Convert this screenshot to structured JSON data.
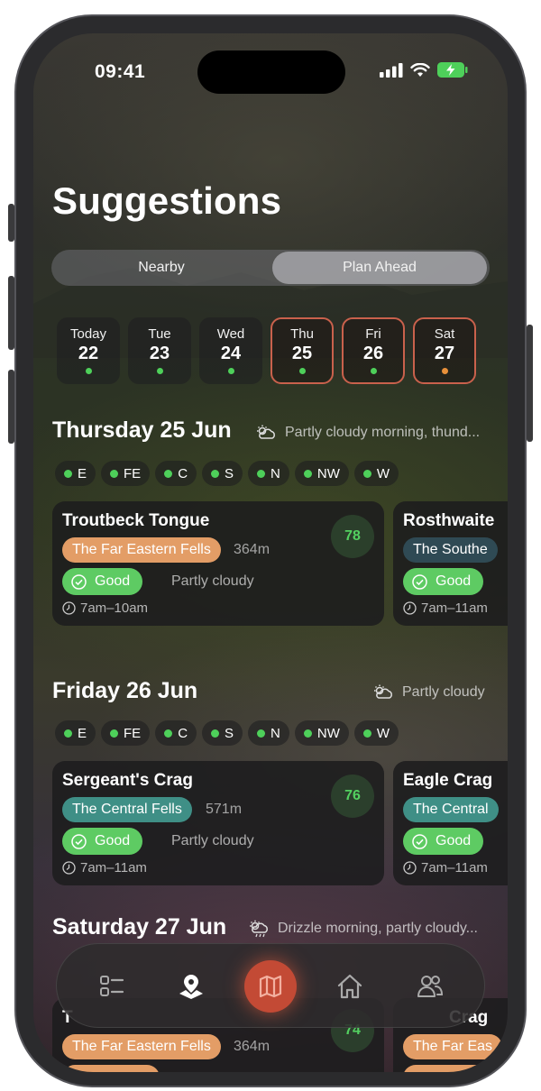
{
  "status": {
    "time": "09:41"
  },
  "page": {
    "title": "Suggestions"
  },
  "segmented": {
    "options": [
      "Nearby",
      "Plan Ahead"
    ],
    "selected": "Plan Ahead"
  },
  "days": [
    {
      "name": "Today",
      "date": "22",
      "dot": "#4ed05a",
      "selected": false
    },
    {
      "name": "Tue",
      "date": "23",
      "dot": "#4ed05a",
      "selected": false
    },
    {
      "name": "Wed",
      "date": "24",
      "dot": "#4ed05a",
      "selected": false
    },
    {
      "name": "Thu",
      "date": "25",
      "dot": "#4ed05a",
      "selected": true
    },
    {
      "name": "Fri",
      "date": "26",
      "dot": "#4ed05a",
      "selected": true
    },
    {
      "name": "Sat",
      "date": "27",
      "dot": "#e8903a",
      "selected": true
    }
  ],
  "regions": [
    "E",
    "FE",
    "C",
    "S",
    "N",
    "NW",
    "W"
  ],
  "sections": [
    {
      "heading": "Thursday 25 Jun",
      "weather": "Partly cloudy morning, thund...",
      "weather_icon": "partly-cloudy-thunder-icon",
      "cards": [
        {
          "name": "Troutbeck Tongue",
          "fell": "The Far Eastern Fells",
          "fell_color": "#e39d66",
          "height": "364m",
          "rating": "Good",
          "condition": "Partly cloudy",
          "time": "7am–10am",
          "score": "78"
        },
        {
          "name": "Rosthwaite",
          "fell": "The Southe",
          "fell_color": "#2f4a54",
          "height": "",
          "rating": "Good",
          "condition": "",
          "time": "7am–11am",
          "score": ""
        }
      ]
    },
    {
      "heading": "Friday 26 Jun",
      "weather": "Partly cloudy",
      "weather_icon": "partly-cloudy-icon",
      "cards": [
        {
          "name": "Sergeant's Crag",
          "fell": "The Central Fells",
          "fell_color": "#3f8f86",
          "height": "571m",
          "rating": "Good",
          "condition": "Partly cloudy",
          "time": "7am–11am",
          "score": "76"
        },
        {
          "name": "Eagle Crag",
          "fell": "The Central",
          "fell_color": "#3f8f86",
          "height": "",
          "rating": "Good",
          "condition": "",
          "time": "7am–11am",
          "score": ""
        }
      ]
    },
    {
      "heading": "Saturday 27 Jun",
      "weather": "Drizzle morning, partly cloudy...",
      "weather_icon": "drizzle-icon",
      "cards": [
        {
          "name": "T",
          "fell": "The Far Eastern Fells",
          "fell_color": "#e39d66",
          "height": "364m",
          "score": "74"
        },
        {
          "name": "Crag",
          "fell": "The Far Eas",
          "fell_color": "#e39d66"
        }
      ]
    }
  ],
  "tabbar": {
    "items": [
      "checklist-icon",
      "location-pin-icon",
      "map-icon",
      "home-icon",
      "people-icon"
    ],
    "active": "map-icon",
    "accent": "#c34a35"
  }
}
